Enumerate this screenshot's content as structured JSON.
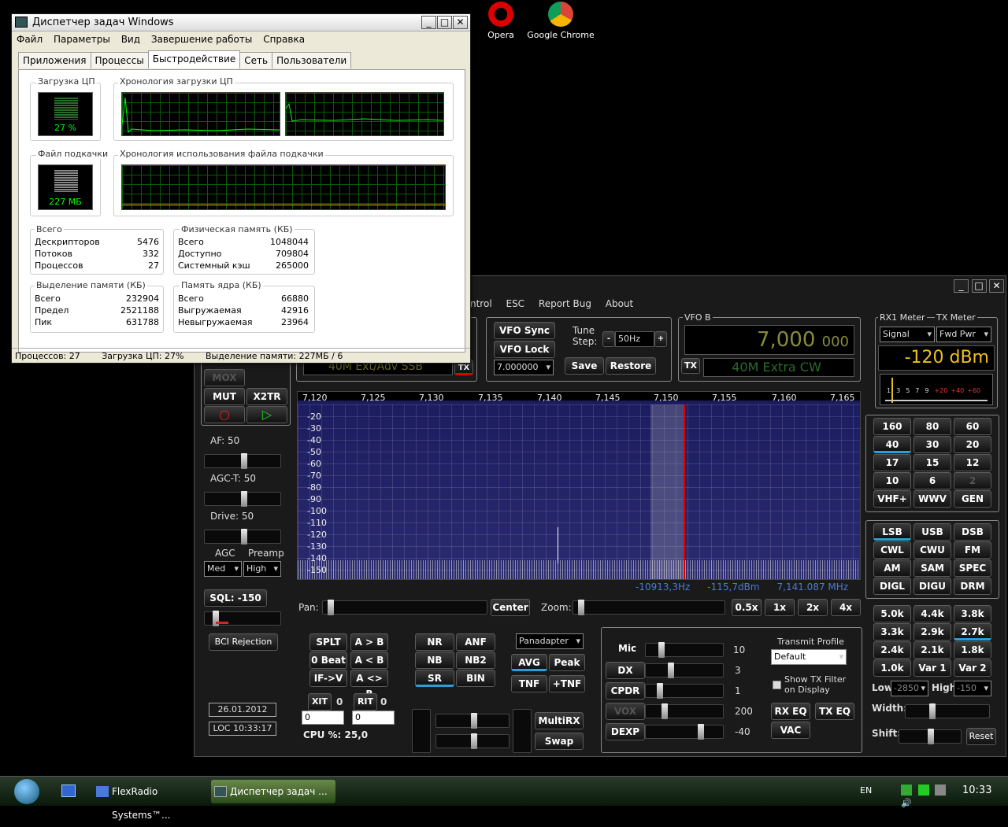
{
  "desktop": {
    "icons": [
      {
        "label": "Opera",
        "icon": "opera-icon"
      },
      {
        "label": "Google Chrome",
        "icon": "chrome-icon"
      }
    ]
  },
  "taskmgr": {
    "title": "Диспетчер задач Windows",
    "menu": [
      "Файл",
      "Параметры",
      "Вид",
      "Завершение работы",
      "Справка"
    ],
    "tabs": [
      "Приложения",
      "Процессы",
      "Быстродействие",
      "Сеть",
      "Пользователи"
    ],
    "active_tab": "Быстродействие",
    "cpu_group": "Загрузка ЦП",
    "cpu_value": "27 %",
    "cpu_hist_group": "Хронология загрузки ЦП",
    "pf_group": "Файл подкачки",
    "pf_value": "227 МБ",
    "pf_hist_group": "Хронология использования файла подкачки",
    "totals": {
      "title": "Всего",
      "rows": [
        [
          "Дескрипторов",
          "5476"
        ],
        [
          "Потоков",
          "332"
        ],
        [
          "Процессов",
          "27"
        ]
      ]
    },
    "physical": {
      "title": "Физическая память (КБ)",
      "rows": [
        [
          "Всего",
          "1048044"
        ],
        [
          "Доступно",
          "709804"
        ],
        [
          "Системный кэш",
          "265000"
        ]
      ]
    },
    "commit": {
      "title": "Выделение памяти (КБ)",
      "rows": [
        [
          "Всего",
          "232904"
        ],
        [
          "Предел",
          "2521188"
        ],
        [
          "Пик",
          "631788"
        ]
      ]
    },
    "kernel": {
      "title": "Память ядра (КБ)",
      "rows": [
        [
          "Всего",
          "66880"
        ],
        [
          "Выгружаемая",
          "42916"
        ],
        [
          "Невыгружаемая",
          "23964"
        ]
      ]
    },
    "status": {
      "processes": "Процессов: 27",
      "cpu": "Загрузка ЦП: 27%",
      "commit": "Выделение памяти: 227МБ / 6"
    }
  },
  "flex": {
    "menu": [
      "ntrol",
      "ESC",
      "Report Bug",
      "About"
    ],
    "vfoa_band": "40M Ext/Adv SSB",
    "vfo_sync": "VFO Sync",
    "vfo_lock": "VFO Lock",
    "vfo_freq_input": "7.000000",
    "tune_step_label": "Tune Step:",
    "tune_step": "50Hz",
    "tune_minus": "-",
    "tune_plus": "+",
    "save": "Save",
    "restore": "Restore",
    "vfob_group": "VFO B",
    "vfob_freq_main": "7,000",
    "vfob_freq_sub": "000",
    "tx_label": "TX",
    "vfob_band": "40M Extra CW",
    "rx_meter_title": "RX1 Meter",
    "tx_meter_title": "TX Meter",
    "rx_meter_sel": "Signal",
    "tx_meter_sel": "Fwd Pwr",
    "dbm": "-120 dBm",
    "meter_scale": [
      "1",
      "3",
      "5",
      "7",
      "9",
      "+20",
      "+40",
      "+60"
    ],
    "left_buttons": {
      "mox": "MOX",
      "mut": "MUT",
      "x2tr": "X2TR"
    },
    "af": "AF:  50",
    "agct": "AGC-T:  50",
    "drive": "Drive:  50",
    "agc_label": "AGC",
    "preamp_label": "Preamp",
    "agc": "Med",
    "preamp": "High",
    "sql": "SQL:  -150",
    "bci": "BCI Rejection",
    "date": "26.01.2012",
    "time": "LOC 10:33:17",
    "freq_ticks": [
      "7,120",
      "7,125",
      "7,130",
      "7,135",
      "7,140",
      "7,145",
      "7,150",
      "7,155",
      "7,160",
      "7,165"
    ],
    "db_ticks": [
      "-20",
      "-30",
      "-40",
      "-50",
      "-60",
      "-70",
      "-80",
      "-90",
      "-100",
      "-110",
      "-120",
      "-130",
      "-140",
      "-150"
    ],
    "readout": {
      "offset": "-10913,3Hz",
      "dbm": "-115,7dBm",
      "freq": "7,141.087 MHz"
    },
    "pan_label": "Pan:",
    "center": "Center",
    "zoom_label": "Zoom:",
    "zoom_buttons": [
      "0.5x",
      "1x",
      "2x",
      "4x"
    ],
    "bands": [
      "160",
      "80",
      "60",
      "40",
      "30",
      "20",
      "17",
      "15",
      "12",
      "10",
      "6",
      "2",
      "VHF+",
      "WWV",
      "GEN"
    ],
    "modes": [
      "LSB",
      "USB",
      "DSB",
      "CWL",
      "CWU",
      "FM",
      "AM",
      "SAM",
      "SPEC",
      "DIGL",
      "DIGU",
      "DRM"
    ],
    "filters": [
      "5.0k",
      "4.4k",
      "3.8k",
      "3.3k",
      "2.9k",
      "2.7k",
      "2.4k",
      "2.1k",
      "1.8k",
      "1.0k",
      "Var 1",
      "Var 2"
    ],
    "low_label": "Low",
    "low": "-2850",
    "high_label": "High",
    "high": "-150",
    "width_label": "Width:",
    "shift_label": "Shift:",
    "reset": "Reset",
    "bottom_left": [
      "SPLT",
      "A > B",
      "0 Beat",
      "A < B",
      "IF->V",
      "A <> B"
    ],
    "xit": "XIT",
    "xit_val": "0",
    "rit": "RIT",
    "rit_val": "0",
    "xit_input": "0",
    "rit_input": "0",
    "cpu": "CPU %: 25,0",
    "dsp": [
      "NR",
      "ANF",
      "NB",
      "NB2",
      "SR",
      "BIN"
    ],
    "display_mode": "Panadapter",
    "avg": "AVG",
    "peak": "Peak",
    "tnf": "TNF",
    "ptnf": "+TNF",
    "multirx": "MultiRX",
    "swap": "Swap",
    "tx_rows": [
      {
        "label": "Mic",
        "value": "10"
      },
      {
        "label": "DX",
        "value": "3"
      },
      {
        "label": "CPDR",
        "value": "1"
      },
      {
        "label": "VOX",
        "value": "200"
      },
      {
        "label": "DEXP",
        "value": "-40"
      }
    ],
    "transmit_profile": "Transmit Profile",
    "profile": "Default",
    "show_tx_filter": "Show TX Filter on Display",
    "rx_eq": "RX EQ",
    "tx_eq": "TX EQ",
    "vac": "VAC"
  },
  "taskbar": {
    "items": [
      "FlexRadio Systems™...",
      "Диспетчер задач ..."
    ],
    "lang": "EN",
    "clock": "10:33"
  }
}
